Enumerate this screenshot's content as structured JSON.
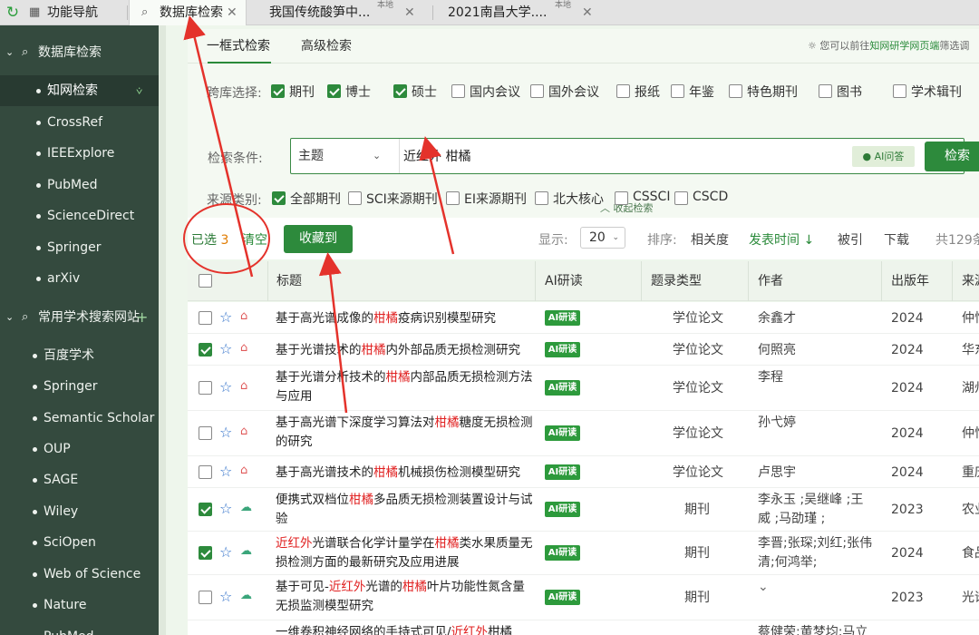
{
  "tabs": [
    {
      "label": "功能导航",
      "icon": "grid-icon"
    },
    {
      "label": "数据库检索",
      "icon": "search-icon",
      "active": true
    },
    {
      "label": "我国传统酸笋中...",
      "badge": "本地"
    },
    {
      "label": "2021南昌大学....",
      "badge": "本地"
    }
  ],
  "sidebar": {
    "group1": {
      "label": "数据库检索"
    },
    "items1": [
      {
        "label": "知网检索",
        "active": true
      },
      {
        "label": "CrossRef"
      },
      {
        "label": "IEEExplore"
      },
      {
        "label": "PubMed"
      },
      {
        "label": "ScienceDirect"
      },
      {
        "label": "Springer"
      },
      {
        "label": "arXiv"
      }
    ],
    "group2": {
      "label": "常用学术搜索网站",
      "plus": "+"
    },
    "items2": [
      {
        "label": "百度学术"
      },
      {
        "label": "Springer"
      },
      {
        "label": "Semantic Scholar"
      },
      {
        "label": "OUP"
      },
      {
        "label": "SAGE"
      },
      {
        "label": "Wiley"
      },
      {
        "label": "SciOpen"
      },
      {
        "label": "Web of Science"
      },
      {
        "label": "Nature"
      },
      {
        "label": "PubMed"
      }
    ]
  },
  "search": {
    "tab_simple": "一框式检索",
    "tab_advanced": "高级检索",
    "hint_prefix": "您可以前往",
    "hint_link": "知网研学网页端",
    "hint_suffix": "筛选调",
    "db_label": "跨库选择:",
    "databases": [
      {
        "label": "期刊",
        "checked": true
      },
      {
        "label": "博士",
        "checked": true
      },
      {
        "label": "硕士",
        "checked": true
      },
      {
        "label": "国内会议",
        "checked": false
      },
      {
        "label": "国外会议",
        "checked": false
      },
      {
        "label": "报纸",
        "checked": false
      },
      {
        "label": "年鉴",
        "checked": false
      },
      {
        "label": "特色期刊",
        "checked": false
      },
      {
        "label": "图书",
        "checked": false
      },
      {
        "label": "学术辑刊",
        "checked": false
      }
    ],
    "cond_label": "检索条件:",
    "field": "主题",
    "query": "近红外 柑橘",
    "ai_label": "AI问答",
    "search_label": "检索",
    "source_label": "来源类别:",
    "sources": [
      {
        "label": "全部期刊",
        "checked": true
      },
      {
        "label": "SCI来源期刊",
        "checked": false
      },
      {
        "label": "EI来源期刊",
        "checked": false
      },
      {
        "label": "北大核心",
        "checked": false
      },
      {
        "label": "CSSCI",
        "checked": false
      },
      {
        "label": "CSCD",
        "checked": false
      }
    ],
    "collapse_label": "收起检索"
  },
  "toolbar": {
    "selected_prefix": "已选",
    "selected_count": "3",
    "clear_label": "清空",
    "collect_label": "收藏到",
    "display_label": "显示:",
    "page_size": "20",
    "sort_label": "排序:",
    "sort_relevance": "相关度",
    "sort_time": "发表时间",
    "sort_time_arrow": "↓",
    "sort_cited": "被引",
    "sort_download": "下载",
    "total": "共129条"
  },
  "columns": {
    "title": "标题",
    "ai": "AI研读",
    "type": "题录类型",
    "author": "作者",
    "year": "出版年",
    "source": "来源"
  },
  "rows": [
    {
      "checked": false,
      "fmt": "pdf",
      "title_parts": [
        "基于高光谱成像的",
        "柑橘",
        "疫病识别模型研究"
      ],
      "ai": "AI研读",
      "type": "学位论文",
      "author": "余鑫才",
      "year": "2024",
      "source": "仲恺"
    },
    {
      "checked": true,
      "fmt": "pdf",
      "title_parts": [
        "基于光谱技术的",
        "柑橘",
        "内外部品质无损检测研究"
      ],
      "ai": "AI研读",
      "type": "学位论文",
      "author": "何照亮",
      "year": "2024",
      "source": "华东"
    },
    {
      "checked": false,
      "fmt": "pdf",
      "title_parts": [
        "基于光谱分析技术的",
        "柑橘",
        "内部品质无损检测方法与应用"
      ],
      "ai": "AI研读",
      "type": "学位论文",
      "author": "李程",
      "year": "2024",
      "source": "湖州"
    },
    {
      "checked": false,
      "fmt": "pdf",
      "title_parts": [
        "基于高光谱下深度学习算法对",
        "柑橘",
        "糖度无损检测的研究"
      ],
      "ai": "AI研读",
      "type": "学位论文",
      "author": "孙弋婷",
      "year": "2024",
      "source": "仲恺"
    },
    {
      "checked": false,
      "fmt": "pdf",
      "title_parts": [
        "基于高光谱技术的",
        "柑橘",
        "机械损伤检测模型研究"
      ],
      "ai": "AI研读",
      "type": "学位论文",
      "author": "卢思宇",
      "year": "2024",
      "source": "重庆"
    },
    {
      "checked": true,
      "fmt": "cloud",
      "title_parts": [
        "便携式双档位",
        "柑橘",
        "多品质无损检测装置设计与试验"
      ],
      "ai": "AI研读",
      "type": "期刊",
      "author": "李永玉 ;吴继峰 ;王威 ;马劭瑾 ;",
      "year": "2023",
      "source": "农业"
    },
    {
      "checked": true,
      "fmt": "cloud",
      "title_parts": [
        "",
        "近红外",
        "光谱联合化学计量学在",
        "柑橘",
        "类水果质量无损检测方面的最新研究及应用进展"
      ],
      "ai": "AI研读",
      "type": "期刊",
      "author": "李晋;张琛;刘红;张伟清;何鸿举;",
      "year": "2024",
      "source": "食品"
    },
    {
      "checked": false,
      "fmt": "cloud",
      "title_parts": [
        "基于可见-",
        "近红外",
        "光谱的",
        "柑橘",
        "叶片功能性氮含量无损监测模型研究"
      ],
      "ai": "AI研读",
      "type": "期刊",
      "author": "杨群;凌琪涵;魏勇;宇强;孔发明",
      "author_more": "⌄",
      "year": "2023",
      "source": "光谱"
    },
    {
      "checked": false,
      "fmt": "cloud",
      "title_parts": [
        "一维卷积神经网络的手持式可见/",
        "近红外",
        "柑橘"
      ],
      "ai": "",
      "type": "",
      "author": "蔡健荣;黄梦均;马立",
      "year": "",
      "source": ""
    }
  ]
}
